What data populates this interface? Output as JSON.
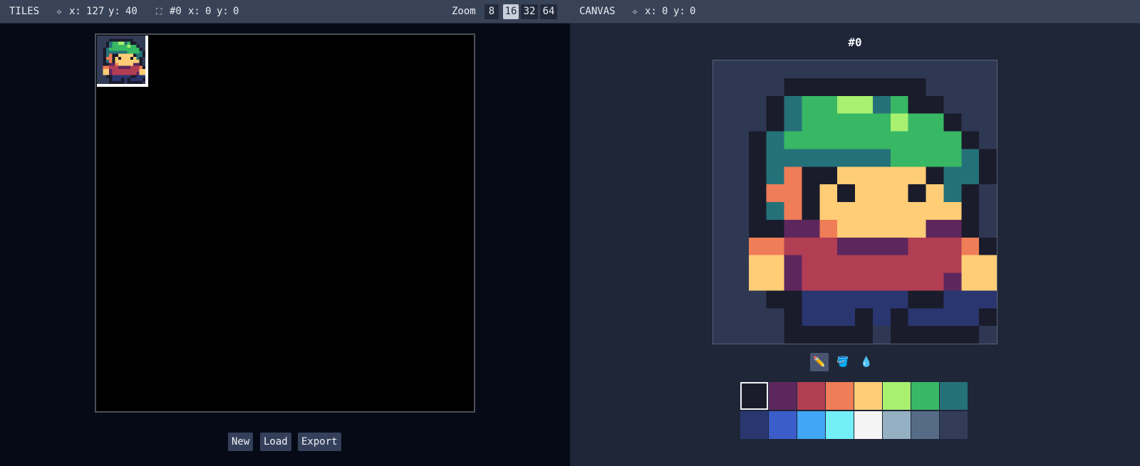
{
  "tiles_panel": {
    "title": "TILES",
    "cursor": {
      "icon": "crosshair-icon",
      "glyph": "⟡",
      "x_label": "x:",
      "x": "127",
      "y_label": "y:",
      "y": "40"
    },
    "selection": {
      "icon": "selection-icon",
      "glyph": "⛶",
      "tile": "#0",
      "x_label": "x:",
      "x": "0",
      "y_label": "y:",
      "y": "0"
    },
    "zoom_label": "Zoom",
    "zoom_levels": [
      "8",
      "16",
      "32",
      "64"
    ],
    "zoom_active": "16",
    "buttons": {
      "new": "New",
      "load": "Load",
      "export": "Export"
    }
  },
  "canvas_panel": {
    "title": "CANVAS",
    "cursor": {
      "icon": "crosshair-icon",
      "glyph": "⟡",
      "x_label": "x:",
      "x": "0",
      "y_label": "y:",
      "y": "0"
    },
    "tile_id": "#0",
    "tools": [
      {
        "name": "pencil-tool",
        "glyph": "✏️",
        "active": true
      },
      {
        "name": "fill-tool",
        "glyph": "🪣",
        "active": false
      },
      {
        "name": "eyedropper-tool",
        "glyph": "💧",
        "active": false
      }
    ]
  },
  "palette": {
    "selected_index": 0,
    "colors": [
      "#1a1c2c",
      "#5d275d",
      "#b13e53",
      "#ef7d57",
      "#ffcd75",
      "#a7f070",
      "#38b764",
      "#257179",
      "#29366f",
      "#3b5dc9",
      "#41a6f6",
      "#73eff7",
      "#f4f4f4",
      "#94b0c2",
      "#566c86",
      "#333c57"
    ]
  },
  "sprite": {
    "size": 16,
    "rows": [
      "FFFFFFFFFFFFFFFF",
      "FFFF00000000FFFF",
      "FFF0766557600FFF",
      "FFF07666665660FF",
      "FF0766666666660F",
      "FF07777777666670F",
      "FF07300444440770F",
      "FF0330404440470F",
      "FF0730444444440F",
      "FF0011344444110F",
      "FF33222111122230",
      "FF4412222222224430",
      "FF4412222222214430",
      "FFF00888888008880F",
      "FFFF0888080888800F",
      "FFFF00000F00000FF"
    ]
  }
}
